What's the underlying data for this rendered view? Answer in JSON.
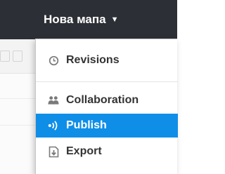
{
  "header": {
    "map_title": "Нова мапа",
    "caret": "▼"
  },
  "menu": {
    "items": [
      {
        "label": "Revisions",
        "icon": "clock-icon",
        "selected": false
      },
      {
        "label": "Collaboration",
        "icon": "users-icon",
        "selected": false
      },
      {
        "label": "Publish",
        "icon": "broadcast-icon",
        "selected": true
      },
      {
        "label": "Export",
        "icon": "export-icon",
        "selected": false
      }
    ]
  },
  "colors": {
    "topbar": "#2c2f35",
    "highlight": "#0f8ee8",
    "icon": "#7a7a7a",
    "label": "#333333"
  }
}
